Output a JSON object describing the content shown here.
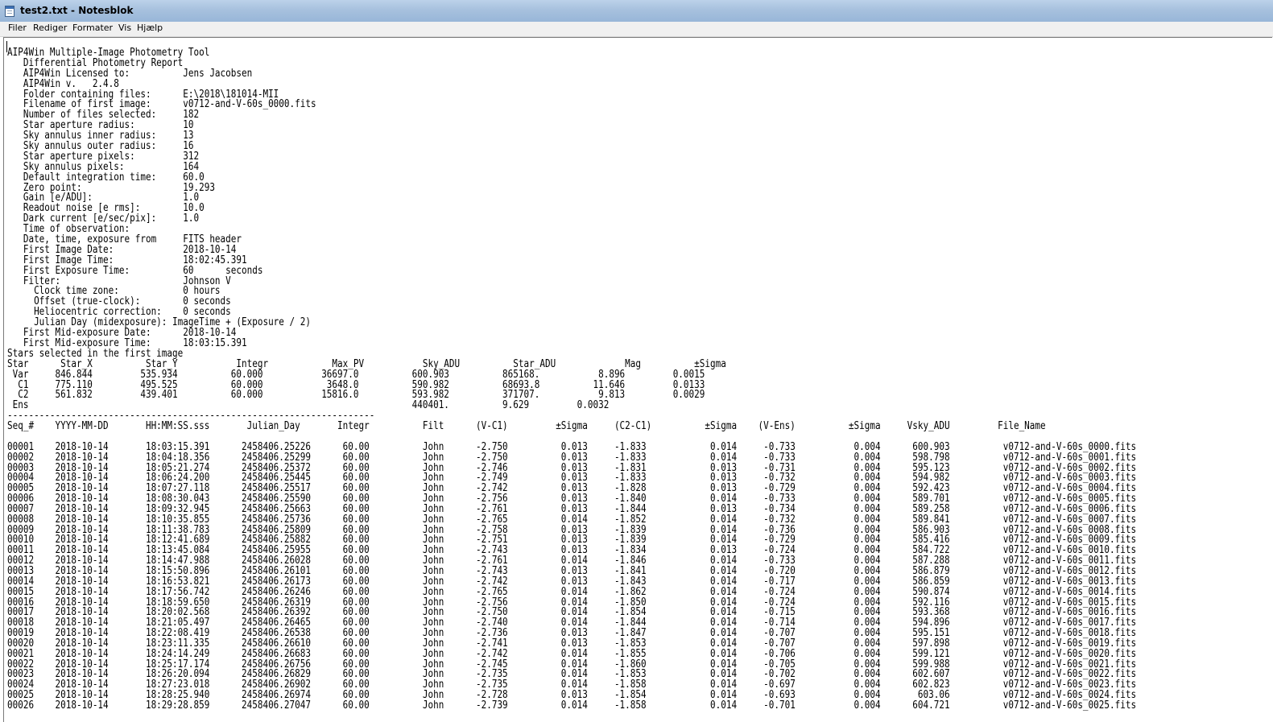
{
  "window": {
    "title": "test2.txt - Notesblok",
    "menu": [
      "Filer",
      "Rediger",
      "Formater",
      "Vis",
      "Hjælp"
    ]
  },
  "document": {
    "lines": [
      "AIP4Win Multiple-Image Photometry Tool",
      "   Differential Photometry Report",
      "   AIP4Win Licensed to:          Jens Jacobsen",
      "   AIP4Win v.   2.4.8",
      "   Folder containing files:      E:\\2018\\181014-MII",
      "   Filename of first image:      v0712-and-V-60s_0000.fits",
      "   Number of files selected:     182",
      "   Star aperture radius:         10",
      "   Sky annulus inner radius:     13",
      "   Sky annulus outer radius:     16",
      "   Star aperture pixels:         312",
      "   Sky annulus pixels:           164",
      "   Default integration time:     60.0",
      "   Zero point:                   19.293",
      "   Gain [e/ADU]:                 1.0",
      "   Readout noise [e rms]:        10.0",
      "   Dark current [e/sec/pix]:     1.0",
      "   Time of observation:",
      "   Date, time, exposure from     FITS header",
      "   First Image Date:             2018-10-14",
      "   First Image Time:             18:02:45.391",
      "   First Exposure Time:          60      seconds",
      "   Filter:                       Johnson V",
      "     Clock time zone:            0 hours",
      "     Offset (true-clock):        0 seconds",
      "     Heliocentric correction:    0 seconds",
      "     Julian Day (midexposure): ImageTime + (Exposure / 2)",
      "   First Mid-exposure Date:      2018-10-14",
      "   First Mid-exposure Time:      18:03:15.391",
      "Stars selected in the first image",
      "Star      Star_X          Star_Y           Integr            Max_PV           Sky_ADU          Star_ADU             Mag          ±Sigma",
      " Var     846.844         535.934          60.000           36697.0          600.903          865168.           8.896         0.0015",
      "  C1     775.110         495.525          60.000            3648.0          590.982          68693.8          11.646         0.0133",
      "  C2     561.832         439.401          60.000           15816.0          593.982          371707.           9.813         0.0029",
      " Ens                                                                        440401.          9.629         0.0032",
      "---------------------------------------------------------------------",
      "Seq_#    YYYY-MM-DD       HH:MM:SS.sss       Julian_Day       Integr          Filt      (V-C1)         ±Sigma     (C2-C1)          ±Sigma    (V-Ens)          ±Sigma     Vsky_ADU         File_Name",
      "",
      "00001    2018-10-14       18:03:15.391      2458406.25226      60.00          John      -2.750          0.013     -1.833            0.014     -0.733           0.004      600.903          v0712-and-V-60s_0000.fits",
      "00002    2018-10-14       18:04:18.356      2458406.25299      60.00          John      -2.750          0.013     -1.833            0.014     -0.733           0.004      598.798          v0712-and-V-60s_0001.fits",
      "00003    2018-10-14       18:05:21.274      2458406.25372      60.00          John      -2.746          0.013     -1.831            0.013     -0.731           0.004      595.123          v0712-and-V-60s_0002.fits",
      "00004    2018-10-14       18:06:24.200      2458406.25445      60.00          John      -2.749          0.013     -1.833            0.013     -0.732           0.004      594.982          v0712-and-V-60s_0003.fits",
      "00005    2018-10-14       18:07:27.118      2458406.25517      60.00          John      -2.742          0.013     -1.828            0.013     -0.729           0.004      592.423          v0712-and-V-60s_0004.fits",
      "00006    2018-10-14       18:08:30.043      2458406.25590      60.00          John      -2.756          0.013     -1.840            0.014     -0.733           0.004      589.701          v0712-and-V-60s_0005.fits",
      "00007    2018-10-14       18:09:32.945      2458406.25663      60.00          John      -2.761          0.013     -1.844            0.013     -0.734           0.004      589.258          v0712-and-V-60s_0006.fits",
      "00008    2018-10-14       18:10:35.855      2458406.25736      60.00          John      -2.765          0.014     -1.852            0.014     -0.732           0.004      589.841          v0712-and-V-60s_0007.fits",
      "00009    2018-10-14       18:11:38.783      2458406.25809      60.00          John      -2.758          0.013     -1.839            0.014     -0.736           0.004      586.903          v0712-and-V-60s_0008.fits",
      "00010    2018-10-14       18:12:41.689      2458406.25882      60.00          John      -2.751          0.013     -1.839            0.014     -0.729           0.004      585.416          v0712-and-V-60s_0009.fits",
      "00011    2018-10-14       18:13:45.084      2458406.25955      60.00          John      -2.743          0.013     -1.834            0.013     -0.724           0.004      584.722          v0712-and-V-60s_0010.fits",
      "00012    2018-10-14       18:14:47.988      2458406.26028      60.00          John      -2.761          0.014     -1.846            0.014     -0.733           0.004      587.288          v0712-and-V-60s_0011.fits",
      "00013    2018-10-14       18:15:50.896      2458406.26101      60.00          John      -2.743          0.013     -1.841            0.014     -0.720           0.004      586.879          v0712-and-V-60s_0012.fits",
      "00014    2018-10-14       18:16:53.821      2458406.26173      60.00          John      -2.742          0.013     -1.843            0.014     -0.717           0.004      586.859          v0712-and-V-60s_0013.fits",
      "00015    2018-10-14       18:17:56.742      2458406.26246      60.00          John      -2.765          0.014     -1.862            0.014     -0.724           0.004      590.874          v0712-and-V-60s_0014.fits",
      "00016    2018-10-14       18:18:59.650      2458406.26319      60.00          John      -2.756          0.014     -1.850            0.014     -0.724           0.004      592.116          v0712-and-V-60s_0015.fits",
      "00017    2018-10-14       18:20:02.568      2458406.26392      60.00          John      -2.750          0.014     -1.854            0.014     -0.715           0.004      593.368          v0712-and-V-60s_0016.fits",
      "00018    2018-10-14       18:21:05.497      2458406.26465      60.00          John      -2.740          0.014     -1.844            0.014     -0.714           0.004      594.896          v0712-and-V-60s_0017.fits",
      "00019    2018-10-14       18:22:08.419      2458406.26538      60.00          John      -2.736          0.013     -1.847            0.014     -0.707           0.004      595.151          v0712-and-V-60s_0018.fits",
      "00020    2018-10-14       18:23:11.335      2458406.26610      60.00          John      -2.741          0.013     -1.853            0.014     -0.707           0.004      597.898          v0712-and-V-60s_0019.fits",
      "00021    2018-10-14       18:24:14.249      2458406.26683      60.00          John      -2.742          0.014     -1.855            0.014     -0.706           0.004      599.121          v0712-and-V-60s_0020.fits",
      "00022    2018-10-14       18:25:17.174      2458406.26756      60.00          John      -2.745          0.014     -1.860            0.014     -0.705           0.004      599.988          v0712-and-V-60s_0021.fits",
      "00023    2018-10-14       18:26:20.094      2458406.26829      60.00          John      -2.735          0.014     -1.853            0.014     -0.702           0.004      602.607          v0712-and-V-60s_0022.fits",
      "00024    2018-10-14       18:27:23.018      2458406.26902      60.00          John      -2.735          0.014     -1.858            0.014     -0.697           0.004      602.823          v0712-and-V-60s_0023.fits",
      "00025    2018-10-14       18:28:25.940      2458406.26974      60.00          John      -2.728          0.013     -1.854            0.014     -0.693           0.004       603.06          v0712-and-V-60s_0024.fits",
      "00026    2018-10-14       18:29:28.859      2458406.27047      60.00          John      -2.739          0.014     -1.858            0.014     -0.701           0.004      604.721          v0712-and-V-60s_0025.fits"
    ]
  }
}
